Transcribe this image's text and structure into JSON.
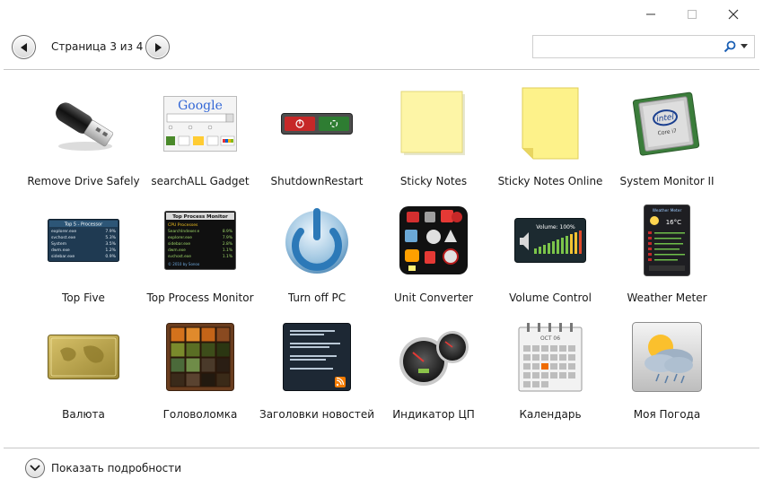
{
  "window": {
    "controls": [
      "minimize",
      "maximize",
      "close"
    ]
  },
  "toolbar": {
    "page_label": "Страница 3 из 4",
    "search_value": "",
    "search_placeholder": ""
  },
  "gadgets": [
    {
      "label": "Remove Drive Safely",
      "icon": "usb-drive-icon"
    },
    {
      "label": "searchALL Gadget",
      "icon": "google-search-icon",
      "thumb_text": "Google"
    },
    {
      "label": "ShutdownRestart",
      "icon": "shutdown-restart-icon"
    },
    {
      "label": "Sticky Notes",
      "icon": "sticky-note-icon"
    },
    {
      "label": "Sticky Notes Online",
      "icon": "sticky-note-online-icon"
    },
    {
      "label": "System Monitor II",
      "icon": "cpu-chip-icon",
      "thumb_text": "intel",
      "thumb_sub": "Core i7"
    },
    {
      "label": "Top Five",
      "icon": "top-five-panel-icon",
      "thumb_text": "Top 5 - Processor",
      "thumb_rows": [
        [
          "explorer.exe",
          "7.9%"
        ],
        [
          "svchost.exe",
          "5.3%"
        ],
        [
          "System",
          "3.5%"
        ],
        [
          "dwm.exe",
          "1.2%"
        ],
        [
          "sidebar.exe",
          "0.9%"
        ]
      ]
    },
    {
      "label": "Top Process Monitor",
      "icon": "process-monitor-icon",
      "thumb_text": "Top Process Monitor",
      "thumb_sub": "CPU Processes",
      "thumb_rows": [
        [
          "SearchIndexer.e",
          "8.9%"
        ],
        [
          "explorer.exe",
          "7.9%"
        ],
        [
          "sidebar.exe",
          "2.8%"
        ],
        [
          "dwm.exe",
          "1.1%"
        ],
        [
          "svchost.exe",
          "1.1%"
        ]
      ],
      "thumb_footer": "© 2010 by Sonoo"
    },
    {
      "label": "Turn off PC",
      "icon": "power-button-icon"
    },
    {
      "label": "Unit Converter",
      "icon": "unit-converter-icon"
    },
    {
      "label": "Volume Control",
      "icon": "volume-control-icon",
      "thumb_text": "Volume: 100%"
    },
    {
      "label": "Weather Meter",
      "icon": "weather-meter-icon",
      "thumb_text": "Weather Meter",
      "thumb_sub": "16°C"
    },
    {
      "label": "Валюта",
      "icon": "currency-card-icon"
    },
    {
      "label": "Головоломка",
      "icon": "puzzle-icon"
    },
    {
      "label": "Заголовки новостей",
      "icon": "news-headlines-icon"
    },
    {
      "label": "Индикатор ЦП",
      "icon": "cpu-meter-icon"
    },
    {
      "label": "Календарь",
      "icon": "calendar-icon",
      "thumb_text": "OCT 06"
    },
    {
      "label": "Моя Погода",
      "icon": "weather-cloud-icon"
    }
  ],
  "footer": {
    "details_label": "Показать подробности"
  },
  "colors": {
    "divider": "#c8c8c8",
    "text": "#1a1a1a",
    "button_border": "#6b6b6b"
  }
}
